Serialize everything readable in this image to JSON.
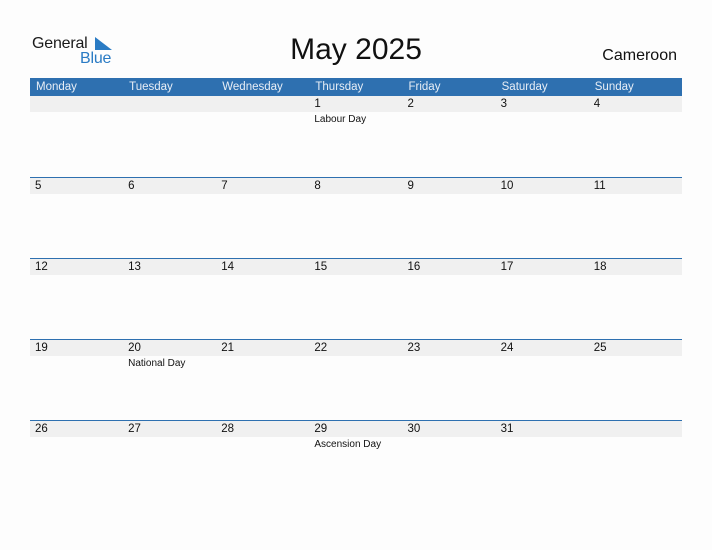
{
  "logo": {
    "word1": "General",
    "word2": "Blue",
    "accent_color": "#2a7bc4"
  },
  "header": {
    "title": "May 2025",
    "country": "Cameroon"
  },
  "colors": {
    "header_bg": "#2e70b0",
    "date_strip_bg": "#f0f0f0"
  },
  "weekdays": [
    "Monday",
    "Tuesday",
    "Wednesday",
    "Thursday",
    "Friday",
    "Saturday",
    "Sunday"
  ],
  "weeks": [
    {
      "days": [
        {
          "date": "",
          "holiday": ""
        },
        {
          "date": "",
          "holiday": ""
        },
        {
          "date": "",
          "holiday": ""
        },
        {
          "date": "1",
          "holiday": "Labour Day"
        },
        {
          "date": "2",
          "holiday": ""
        },
        {
          "date": "3",
          "holiday": ""
        },
        {
          "date": "4",
          "holiday": ""
        }
      ]
    },
    {
      "days": [
        {
          "date": "5",
          "holiday": ""
        },
        {
          "date": "6",
          "holiday": ""
        },
        {
          "date": "7",
          "holiday": ""
        },
        {
          "date": "8",
          "holiday": ""
        },
        {
          "date": "9",
          "holiday": ""
        },
        {
          "date": "10",
          "holiday": ""
        },
        {
          "date": "11",
          "holiday": ""
        }
      ]
    },
    {
      "days": [
        {
          "date": "12",
          "holiday": ""
        },
        {
          "date": "13",
          "holiday": ""
        },
        {
          "date": "14",
          "holiday": ""
        },
        {
          "date": "15",
          "holiday": ""
        },
        {
          "date": "16",
          "holiday": ""
        },
        {
          "date": "17",
          "holiday": ""
        },
        {
          "date": "18",
          "holiday": ""
        }
      ]
    },
    {
      "days": [
        {
          "date": "19",
          "holiday": ""
        },
        {
          "date": "20",
          "holiday": "National Day"
        },
        {
          "date": "21",
          "holiday": ""
        },
        {
          "date": "22",
          "holiday": ""
        },
        {
          "date": "23",
          "holiday": ""
        },
        {
          "date": "24",
          "holiday": ""
        },
        {
          "date": "25",
          "holiday": ""
        }
      ]
    },
    {
      "days": [
        {
          "date": "26",
          "holiday": ""
        },
        {
          "date": "27",
          "holiday": ""
        },
        {
          "date": "28",
          "holiday": ""
        },
        {
          "date": "29",
          "holiday": "Ascension Day"
        },
        {
          "date": "30",
          "holiday": ""
        },
        {
          "date": "31",
          "holiday": ""
        },
        {
          "date": "",
          "holiday": ""
        }
      ]
    }
  ]
}
